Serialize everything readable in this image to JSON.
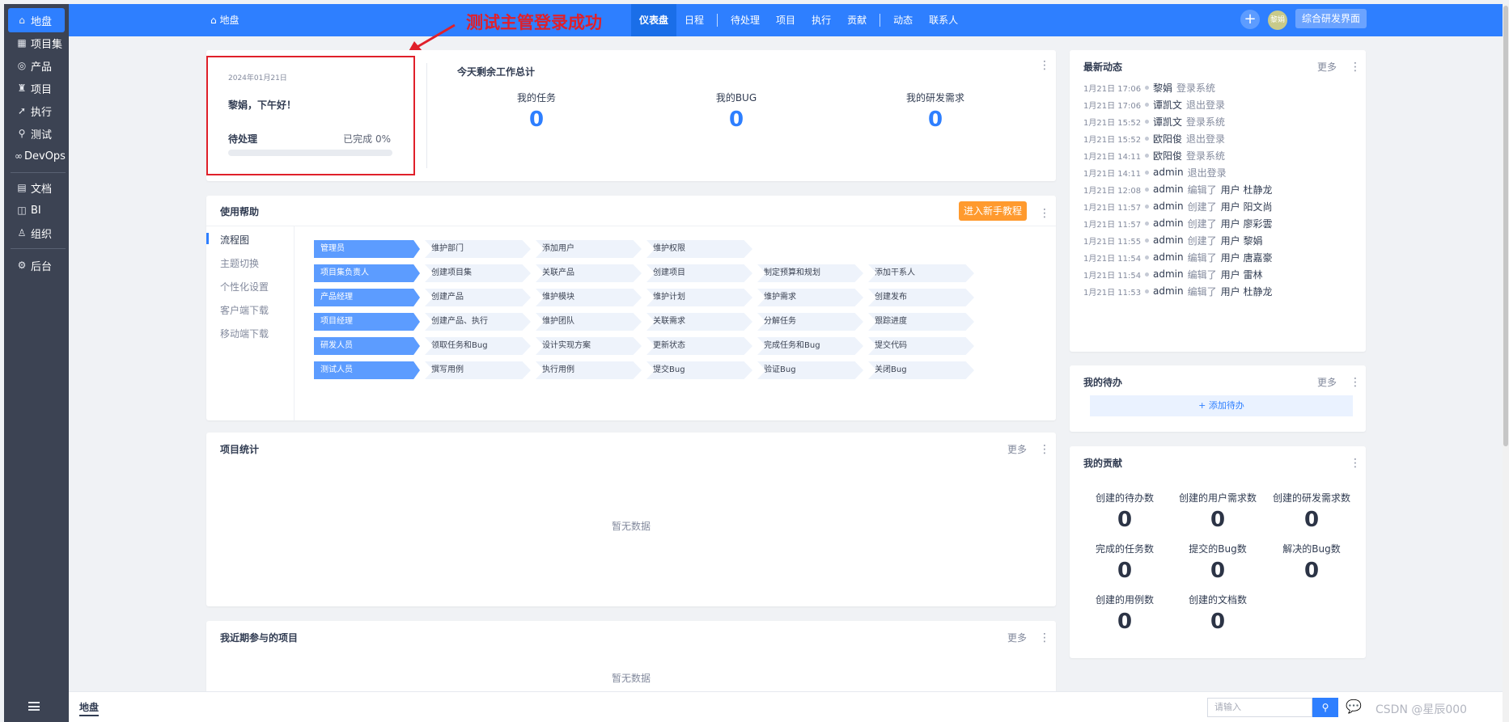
{
  "sidebar": {
    "items": [
      {
        "label": "地盘",
        "icon": "home-icon"
      },
      {
        "label": "项目集",
        "icon": "grid-icon"
      },
      {
        "label": "产品",
        "icon": "product-icon"
      },
      {
        "label": "项目",
        "icon": "project-icon"
      },
      {
        "label": "执行",
        "icon": "run-icon"
      },
      {
        "label": "测试",
        "icon": "test-icon"
      },
      {
        "label": "DevOps",
        "icon": "infinity-icon"
      },
      {
        "label": "文档",
        "icon": "document-icon"
      },
      {
        "label": "BI",
        "icon": "chart-icon"
      },
      {
        "label": "组织",
        "icon": "people-icon"
      },
      {
        "label": "后台",
        "icon": "gear-icon"
      }
    ]
  },
  "header": {
    "crumb": "地盘",
    "nav": [
      "仪表盘",
      "日程",
      "待处理",
      "项目",
      "执行",
      "贡献",
      "动态",
      "联系人"
    ],
    "avatar": "黎娟",
    "space_button": "综合研发界面"
  },
  "annotation": "测试主管登录成功",
  "welcome": {
    "date": "2024年01月21日",
    "greeting": "黎娟，下午好！",
    "pending_label": "待处理",
    "done_label": "已完成 0%",
    "progress_percent": 0
  },
  "today": {
    "title": "今天剩余工作总计",
    "stats": [
      {
        "label": "我的任务",
        "value": "0"
      },
      {
        "label": "我的BUG",
        "value": "0"
      },
      {
        "label": "我的研发需求",
        "value": "0"
      }
    ]
  },
  "help": {
    "title": "使用帮助",
    "tutorial_button": "进入新手教程",
    "tabs": [
      "流程图",
      "主题切换",
      "个性化设置",
      "客户端下载",
      "移动端下载"
    ],
    "flow": [
      {
        "role": "管理员",
        "steps": [
          "维护部门",
          "添加用户",
          "维护权限"
        ]
      },
      {
        "role": "项目集负责人",
        "steps": [
          "创建项目集",
          "关联产品",
          "创建项目",
          "制定预算和规划",
          "添加干系人"
        ]
      },
      {
        "role": "产品经理",
        "steps": [
          "创建产品",
          "维护模块",
          "维护计划",
          "维护需求",
          "创建发布"
        ]
      },
      {
        "role": "项目经理",
        "steps": [
          "创建产品、执行",
          "维护团队",
          "关联需求",
          "分解任务",
          "跟踪进度"
        ]
      },
      {
        "role": "研发人员",
        "steps": [
          "领取任务和Bug",
          "设计实现方案",
          "更新状态",
          "完成任务和Bug",
          "提交代码"
        ]
      },
      {
        "role": "测试人员",
        "steps": [
          "撰写用例",
          "执行用例",
          "提交Bug",
          "验证Bug",
          "关闭Bug"
        ]
      }
    ]
  },
  "project_stats": {
    "title": "项目统计",
    "more": "更多",
    "empty": "暂无数据"
  },
  "recent_projects": {
    "title": "我近期参与的项目",
    "more": "更多",
    "empty": "暂无数据"
  },
  "dynamics": {
    "title": "最新动态",
    "more": "更多",
    "items": [
      {
        "time": "1月21日 17:06",
        "actor": "黎娟",
        "action": "登录系统",
        "object": ""
      },
      {
        "time": "1月21日 17:06",
        "actor": "谭凯文",
        "action": "退出登录",
        "object": ""
      },
      {
        "time": "1月21日 15:52",
        "actor": "谭凯文",
        "action": "登录系统",
        "object": ""
      },
      {
        "time": "1月21日 15:52",
        "actor": "欧阳俊",
        "action": "退出登录",
        "object": ""
      },
      {
        "time": "1月21日 14:11",
        "actor": "欧阳俊",
        "action": "登录系统",
        "object": ""
      },
      {
        "time": "1月21日 14:11",
        "actor": "admin",
        "action": "退出登录",
        "object": ""
      },
      {
        "time": "1月21日 12:08",
        "actor": "admin",
        "action": "编辑了",
        "object": "用户 杜静龙"
      },
      {
        "time": "1月21日 11:57",
        "actor": "admin",
        "action": "创建了",
        "object": "用户 阳文尚"
      },
      {
        "time": "1月21日 11:57",
        "actor": "admin",
        "action": "创建了",
        "object": "用户 廖彩雲"
      },
      {
        "time": "1月21日 11:55",
        "actor": "admin",
        "action": "创建了",
        "object": "用户 黎娟"
      },
      {
        "time": "1月21日 11:54",
        "actor": "admin",
        "action": "编辑了",
        "object": "用户 唐嘉豪"
      },
      {
        "time": "1月21日 11:54",
        "actor": "admin",
        "action": "编辑了",
        "object": "用户 雷林"
      },
      {
        "time": "1月21日 11:53",
        "actor": "admin",
        "action": "编辑了",
        "object": "用户 杜静龙"
      }
    ]
  },
  "todo": {
    "title": "我的待办",
    "more": "更多",
    "add_label": "+ 添加待办"
  },
  "contribution": {
    "title": "我的贡献",
    "items": [
      {
        "label": "创建的待办数",
        "value": "0"
      },
      {
        "label": "创建的用户需求数",
        "value": "0"
      },
      {
        "label": "创建的研发需求数",
        "value": "0"
      },
      {
        "label": "完成的任务数",
        "value": "0"
      },
      {
        "label": "提交的Bug数",
        "value": "0"
      },
      {
        "label": "解决的Bug数",
        "value": "0"
      },
      {
        "label": "创建的用例数",
        "value": "0"
      },
      {
        "label": "创建的文档数",
        "value": "0"
      }
    ]
  },
  "bottom": {
    "crumb": "地盘",
    "search_placeholder": "请输入",
    "watermark": "CSDN @星辰000"
  },
  "colors": {
    "primary": "#2e7fff",
    "sidebar": "#3c4353",
    "annotation": "#e0202a",
    "tutorial": "#ff9a2e"
  }
}
